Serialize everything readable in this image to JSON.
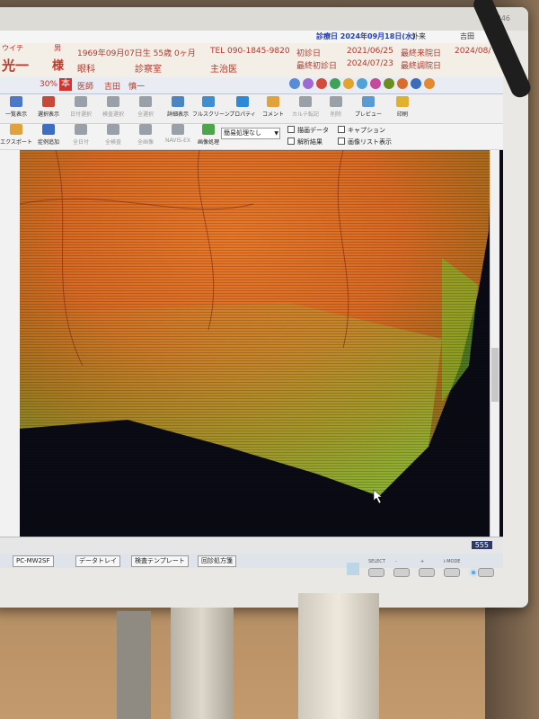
{
  "header": {
    "visit_date": "診療日 2024年09月18日(水)",
    "department": "外来",
    "doctor_short": "吉田",
    "patient_kana": "ウイチ",
    "patient_name": "光一",
    "sex": "男",
    "sama": "様",
    "birth": "1969年09月07日生 55歳 0ヶ月",
    "ward": "眼科",
    "room": "診察室",
    "tel": "TEL 090-1845-9820",
    "chief": "主治医",
    "first_visit_label": "初診日",
    "first_visit_value": "2021/06/25",
    "last_first_label": "最終初診日",
    "last_first_value": "2024/07/23",
    "last_visit_label": "最終来院日",
    "last_visit_value": "2024/08/",
    "last_adjust_label": "最終調院日",
    "percent": "30%",
    "hon_badge": "本",
    "doctor_label": "医師",
    "doctor_name": "吉田　慎一"
  },
  "toolbar": {
    "row1": [
      {
        "label": "一覧表示",
        "icon": "list-icon",
        "color": "#4b78c8",
        "enabled": true
      },
      {
        "label": "選択表示",
        "icon": "select-view-icon",
        "color": "#c7493a",
        "enabled": true
      },
      {
        "label": "日付選択",
        "icon": "calendar-icon",
        "color": "#9aa0a8",
        "enabled": false
      },
      {
        "label": "検査選択",
        "icon": "exam-select-icon",
        "color": "#9aa0a8",
        "enabled": false
      },
      {
        "label": "全選択",
        "icon": "select-all-icon",
        "color": "#9aa0a8",
        "enabled": false
      },
      {
        "label": "詳細表示",
        "icon": "detail-icon",
        "color": "#4a86c5",
        "enabled": true
      },
      {
        "label": "フルスクリーン",
        "icon": "fullscreen-icon",
        "color": "#3f8fd0",
        "enabled": true
      },
      {
        "label": "プロパティ",
        "icon": "property-icon",
        "color": "#2e8ad6",
        "enabled": true
      },
      {
        "label": "コメント",
        "icon": "comment-icon",
        "color": "#e0a23a",
        "enabled": true
      },
      {
        "label": "カルテ転記",
        "icon": "chart-copy-icon",
        "color": "#9aa0a8",
        "enabled": false
      },
      {
        "label": "削除",
        "icon": "delete-icon",
        "color": "#9aa0a8",
        "enabled": false
      },
      {
        "label": "プレビュー",
        "icon": "preview-icon",
        "color": "#5b9bd5",
        "enabled": true
      },
      {
        "label": "印刷",
        "icon": "print-icon",
        "color": "#e0b030",
        "enabled": true
      }
    ],
    "row2": [
      {
        "label": "エクスポート",
        "icon": "export-icon",
        "color": "#e0a23a",
        "enabled": true
      },
      {
        "label": "症例追加",
        "icon": "case-add-icon",
        "color": "#3c6fc4",
        "enabled": true
      },
      {
        "label": "全日付",
        "icon": "all-dates-icon",
        "color": "#9aa0a8",
        "enabled": false
      },
      {
        "label": "全検査",
        "icon": "all-exams-icon",
        "color": "#9aa0a8",
        "enabled": false
      },
      {
        "label": "全画像",
        "icon": "all-images-icon",
        "color": "#9aa0a8",
        "enabled": false
      },
      {
        "label": "NAVIS-EX",
        "icon": "navis-icon",
        "color": "#9aa0a8",
        "enabled": false
      },
      {
        "label": "画像処理",
        "icon": "image-process-icon",
        "color": "#4ca64c",
        "enabled": true
      }
    ],
    "processing_select": "簡易処理なし",
    "checks": [
      {
        "label": "描画データ"
      },
      {
        "label": "キャプション"
      },
      {
        "label": "解析結果"
      },
      {
        "label": "画像リスト表示"
      }
    ]
  },
  "statusbar": {
    "value": "555"
  },
  "taskbar": [
    "PC-MW2SF",
    "データトレイ",
    "検査テンプレート",
    "回診処方箋"
  ],
  "monitor": {
    "model": "9346",
    "buttons": [
      "SELECT",
      "-",
      "+",
      "i-MODE",
      ""
    ]
  }
}
